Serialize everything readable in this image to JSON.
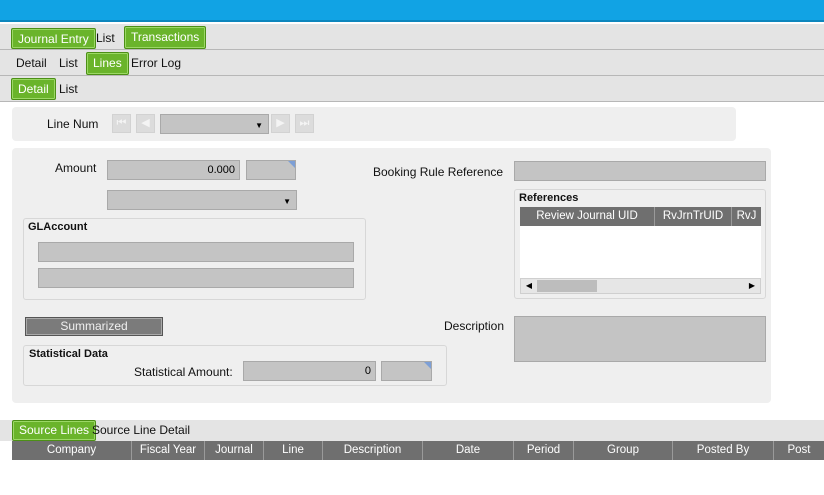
{
  "window": {
    "title_bar_color": "#11a3e4"
  },
  "top_tabs": [
    {
      "label": "Journal Entry",
      "active": true
    },
    {
      "label": "List",
      "active": false
    },
    {
      "label": "Transactions",
      "active": true
    }
  ],
  "second_tabs": [
    {
      "label": "Detail",
      "active": false
    },
    {
      "label": "List",
      "active": false
    },
    {
      "label": "Lines",
      "active": true
    },
    {
      "label": "Error Log",
      "active": false
    }
  ],
  "third_tabs": [
    {
      "label": "Detail",
      "active": true
    },
    {
      "label": "List",
      "active": false
    }
  ],
  "navigator": {
    "label": "Line Num",
    "selected_value": "",
    "first_icon": "first-record-icon",
    "prev_icon": "previous-record-icon",
    "next_icon": "next-record-icon",
    "last_icon": "last-record-icon"
  },
  "detail": {
    "amount_label": "Amount",
    "amount_value": "0.000",
    "currency_value": "",
    "amount_type_value": "",
    "glaccount_title": "GLAccount",
    "glaccount_line1": "",
    "glaccount_line2": "",
    "summarized_label": "Summarized",
    "statistical_title": "Statistical Data",
    "statistical_amount_label": "Statistical Amount:",
    "statistical_amount_value": "0",
    "statistical_unit_value": "",
    "booking_rule_label": "Booking Rule Reference",
    "booking_rule_value": "",
    "references_title": "References",
    "references_columns": [
      "Review Journal UID",
      "RvJrnTrUID",
      "RvJ"
    ],
    "description_label": "Description",
    "description_value": ""
  },
  "bottom_tabs": [
    {
      "label": "Source Lines",
      "active": true
    },
    {
      "label": "Source Line Detail",
      "active": false
    }
  ],
  "source_grid": {
    "columns": [
      "Company",
      "Fiscal Year",
      "Journal",
      "Line",
      "Description",
      "Date",
      "Period",
      "Group",
      "Posted By",
      "Post"
    ]
  },
  "colors": {
    "accent_green": "#6ab42b",
    "grid_header": "#6f6f6f",
    "field_gray": "#c4c4c4"
  }
}
